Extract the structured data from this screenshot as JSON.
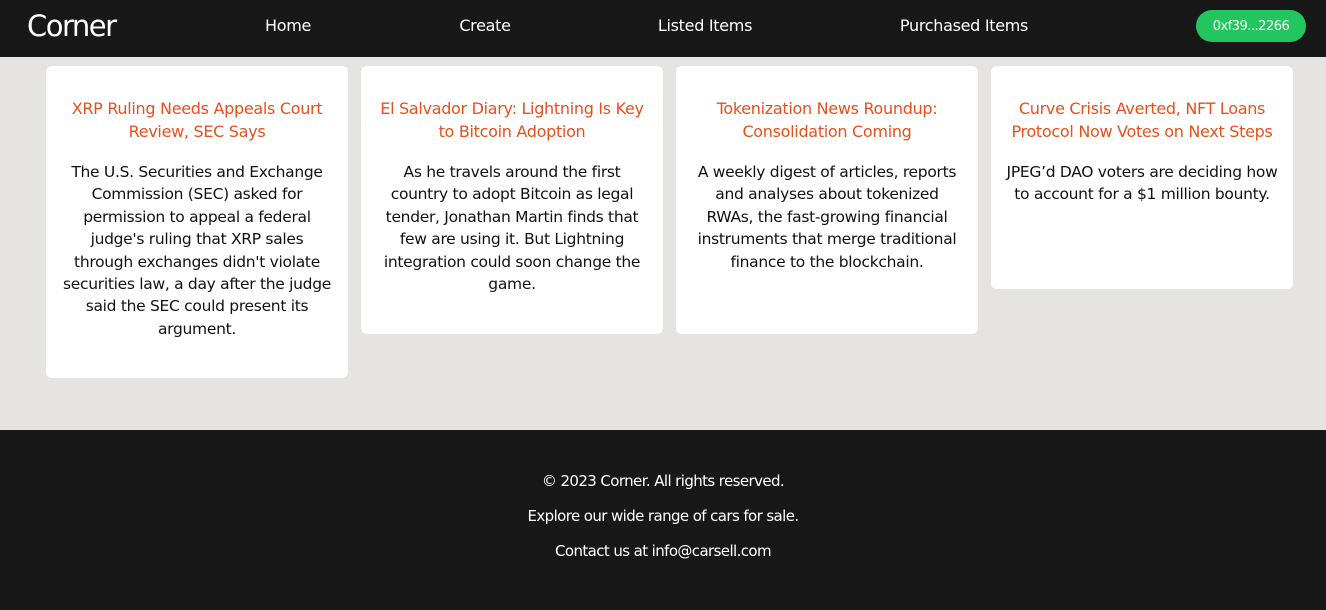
{
  "brand": "Corner",
  "nav": {
    "links": [
      "Home",
      "Create",
      "Listed Items",
      "Purchased Items"
    ],
    "wallet": "0xf39...2266"
  },
  "cards": [
    {
      "title": "XRP Ruling Needs Appeals Court Review, SEC Says",
      "description": "The U.S. Securities and Exchange Commission (SEC) asked for permission to appeal a federal judge's ruling that XRP sales through exchanges didn't violate securities law, a day after the judge said the SEC could present its argument."
    },
    {
      "title": "El Salvador Diary: Lightning Is Key to Bitcoin Adoption",
      "description": "As he travels around the first country to adopt Bitcoin as legal tender, Jonathan Martin finds that few are using it. But Lightning integration could soon change the game."
    },
    {
      "title": "Tokenization News Roundup: Consolidation Coming",
      "description": "A weekly digest of articles, reports and analyses about tokenized RWAs, the fast-growing financial instruments that merge traditional finance to the blockchain."
    },
    {
      "title": "Curve Crisis Averted, NFT Loans Protocol Now Votes on Next Steps",
      "description": "JPEG’d DAO voters are deciding how to account for a $1 million bounty."
    }
  ],
  "footer": {
    "copyright": "© 2023 Corner. All rights reserved.",
    "tagline": "Explore our wide range of cars for sale.",
    "contact": "Contact us at info@carsell.com"
  }
}
